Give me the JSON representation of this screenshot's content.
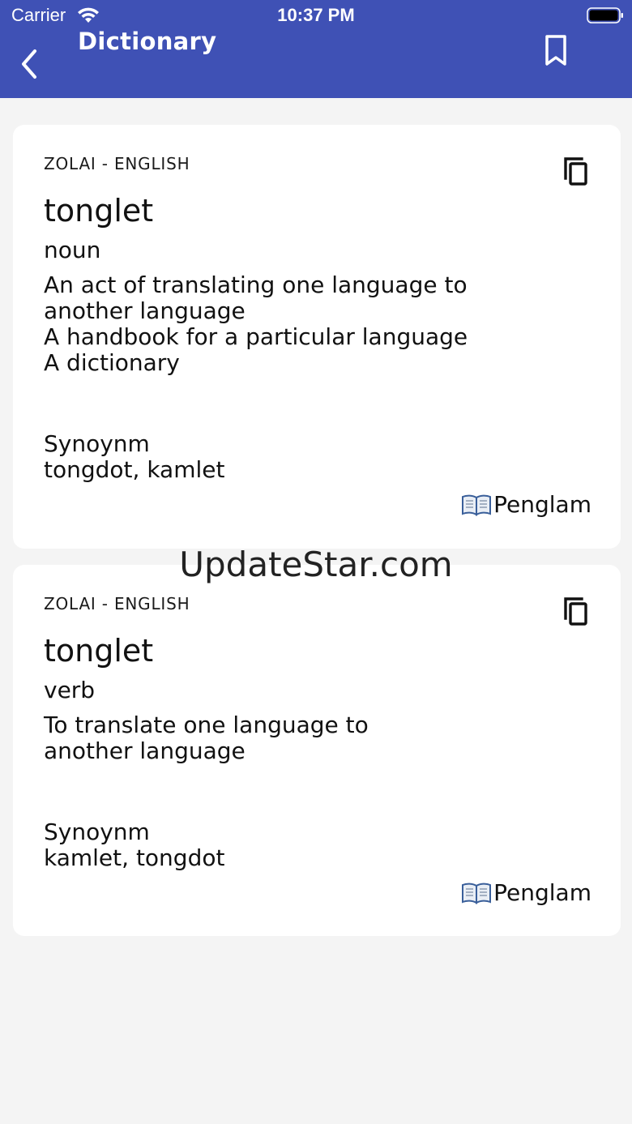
{
  "status_bar": {
    "carrier": "Carrier",
    "time": "10:37 PM"
  },
  "header": {
    "title": "Dictionary",
    "back_icon": "chevron-left-icon",
    "bookmark_icon": "bookmark-icon",
    "background_color": "#3f51b5"
  },
  "entries": [
    {
      "language_pair": "ZOLAI - ENGLISH",
      "word": "tonglet",
      "part_of_speech": "noun",
      "definitions": [
        "An act of translating one language to another language",
        "A handbook for a particular language",
        "A dictionary"
      ],
      "synonym_label": "Synoynm",
      "synonyms": "tongdot, kamlet",
      "source": "Penglam"
    },
    {
      "language_pair": "ZOLAI - ENGLISH",
      "word": "tonglet",
      "part_of_speech": "verb",
      "definitions": [
        "To translate one language to another language"
      ],
      "synonym_label": "Synoynm",
      "synonyms": "kamlet, tongdot",
      "source": "Penglam"
    }
  ],
  "watermark": "UpdateStar.com"
}
